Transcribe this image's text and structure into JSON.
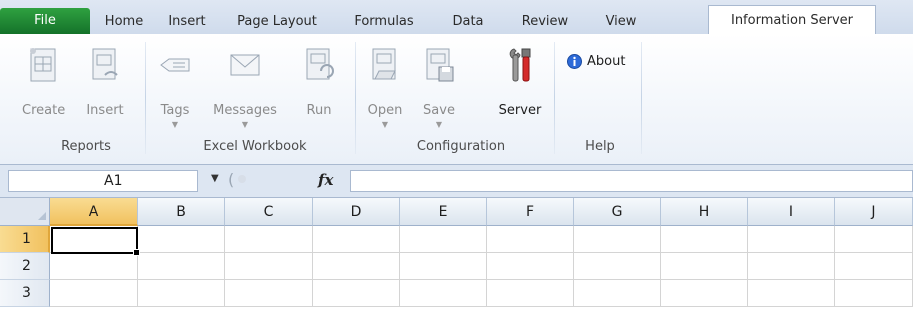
{
  "tabs": [
    {
      "label": "File"
    },
    {
      "label": "Home"
    },
    {
      "label": "Insert"
    },
    {
      "label": "Page Layout"
    },
    {
      "label": "Formulas"
    },
    {
      "label": "Data"
    },
    {
      "label": "Review"
    },
    {
      "label": "View"
    },
    {
      "label": "Information Server",
      "active": true
    }
  ],
  "ribbon": {
    "groups": [
      {
        "label": "Reports",
        "buttons": [
          {
            "label": "Create",
            "icon": "create-report-icon"
          },
          {
            "label": "Insert",
            "icon": "insert-report-icon"
          }
        ]
      },
      {
        "label": "Excel Workbook",
        "buttons": [
          {
            "label": "Tags",
            "icon": "tags-icon",
            "dropdown": true
          },
          {
            "label": "Messages",
            "icon": "messages-icon",
            "dropdown": true
          },
          {
            "label": "Run",
            "icon": "run-icon"
          }
        ]
      },
      {
        "label": "Configuration",
        "buttons": [
          {
            "label": "Open",
            "icon": "open-icon",
            "dropdown": true
          },
          {
            "label": "Save",
            "icon": "save-icon",
            "dropdown": true
          },
          {
            "label": "Server",
            "icon": "server-tools-icon",
            "enabled": true
          }
        ]
      },
      {
        "label": "Help",
        "buttons": [
          {
            "label": "About",
            "icon": "info-icon",
            "enabled": true
          }
        ]
      }
    ]
  },
  "formula_bar": {
    "name_box": "A1",
    "fx": "fx",
    "formula": ""
  },
  "grid": {
    "columns": [
      "A",
      "B",
      "C",
      "D",
      "E",
      "F",
      "G",
      "H",
      "I",
      "J"
    ],
    "rows": [
      "1",
      "2",
      "3"
    ],
    "selected_cell": "A1"
  },
  "colors": {
    "file_tab": "#1e8c36",
    "selection_header": "#f5cf74",
    "ribbon_border": "#a9b9d0"
  }
}
